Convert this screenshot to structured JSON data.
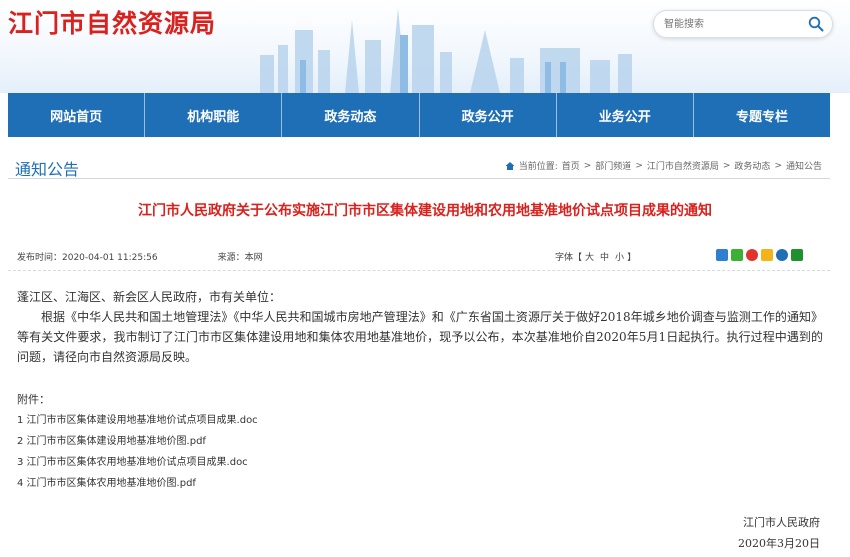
{
  "header": {
    "site_title": "江门市自然资源局",
    "search_placeholder": "智能搜索"
  },
  "nav": {
    "items": [
      "网站首页",
      "机构职能",
      "政务动态",
      "政务公开",
      "业务公开",
      "专题专栏"
    ]
  },
  "section": {
    "title": "通知公告"
  },
  "breadcrumb": {
    "prefix": "当前位置:",
    "items": [
      "首页",
      "部门频道",
      "江门市自然资源局",
      "政务动态",
      "通知公告"
    ],
    "separator": ">"
  },
  "article": {
    "title": "江门市人民政府关于公布实施江门市市区集体建设用地和农用地基准地价试点项目成果的通知",
    "publish_time": "发布时间：2020-04-01 11:25:56",
    "source": "来源：本网",
    "font_label": "字体【",
    "font_large": "大",
    "font_medium": "中",
    "font_small": "小",
    "font_end": "】",
    "greeting": "蓬江区、江海区、新会区人民政府，市有关单位：",
    "paragraph": "根据《中华人民共和国土地管理法》《中华人民共和国城市房地产管理法》和《广东省国土资源厅关于做好2018年城乡地价调查与监测工作的通知》等有关文件要求，我市制订了江门市市区集体建设用地和集体农用地基准地价，现予以公布，本次基准地价自2020年5月1日起执行。执行过程中遇到的问题，请径向市自然资源局反映。",
    "attachments_label": "附件：",
    "attachments": [
      "1 江门市市区集体建设用地基准地价试点项目成果.doc",
      "2 江门市市区集体建设用地基准地价图.pdf",
      "3 江门市市区集体农用地基准地价试点项目成果.doc",
      "4 江门市市区集体农用地基准地价图.pdf"
    ],
    "signature": "江门市人民政府",
    "date": "2020年3月20日"
  },
  "colors": {
    "brand_red": "#d9211d",
    "nav_blue": "#1f6fb6"
  },
  "share_icons": [
    "share-plus-icon",
    "wechat-icon",
    "weibo-icon",
    "qzone-icon",
    "renren-icon",
    "douban-icon"
  ]
}
